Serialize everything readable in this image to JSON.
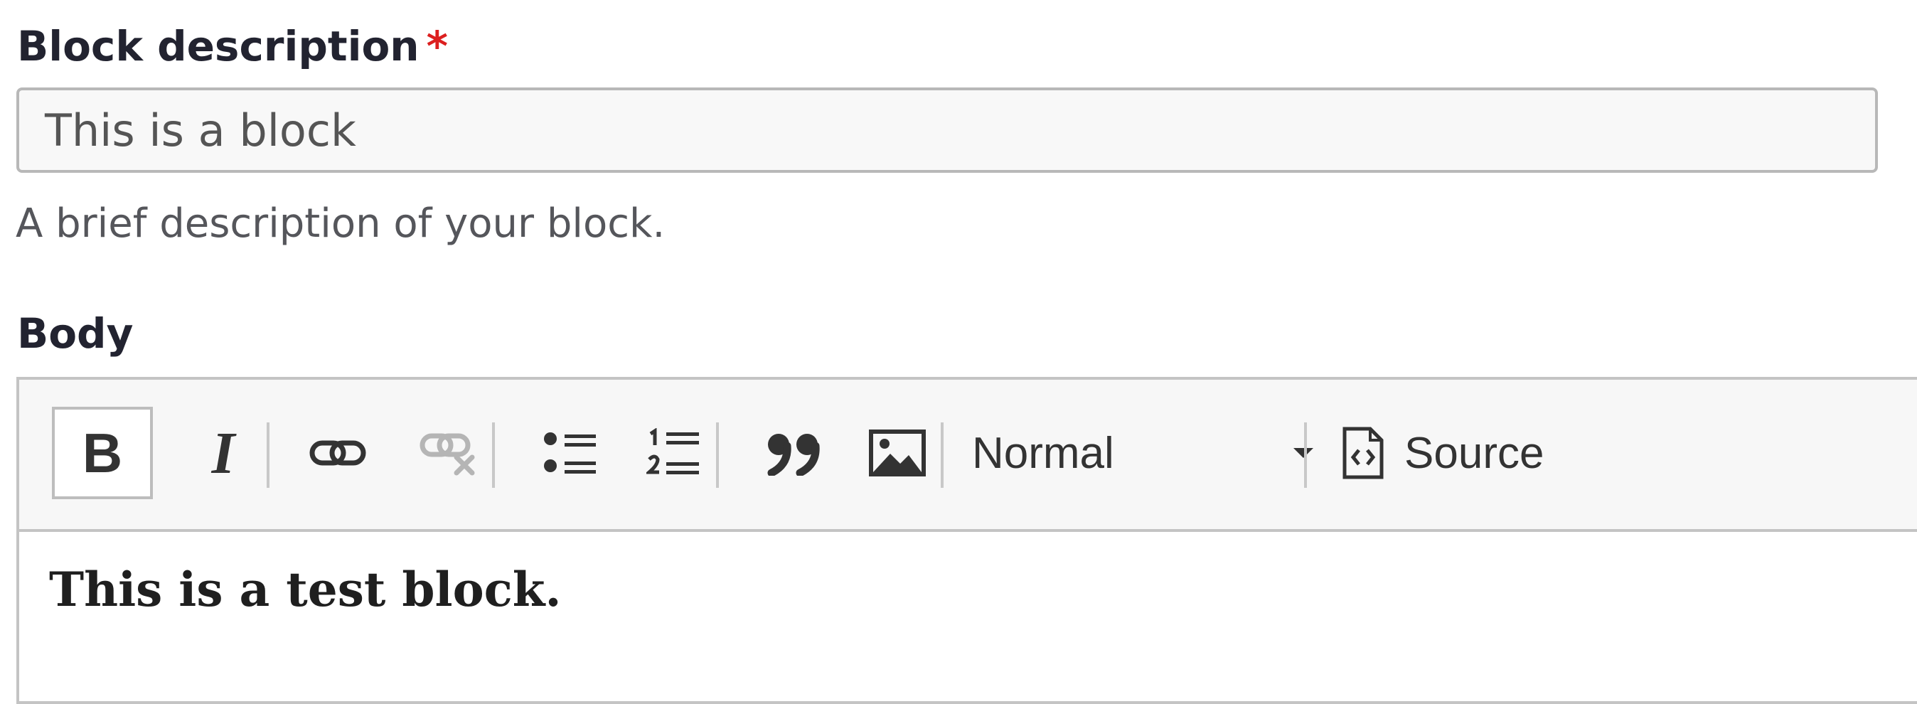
{
  "block_description": {
    "label": "Block description",
    "required_marker": "*",
    "value": "This is a block",
    "help": "A brief description of your block."
  },
  "body": {
    "label": "Body",
    "toolbar": {
      "bold": "B",
      "italic": "I",
      "format": "Normal",
      "source": "Source",
      "icons": [
        "link-icon",
        "unlink-icon",
        "bulleted-list-icon",
        "numbered-list-icon",
        "blockquote-icon",
        "image-icon",
        "source-document-icon"
      ]
    },
    "content": "This is a test block."
  }
}
